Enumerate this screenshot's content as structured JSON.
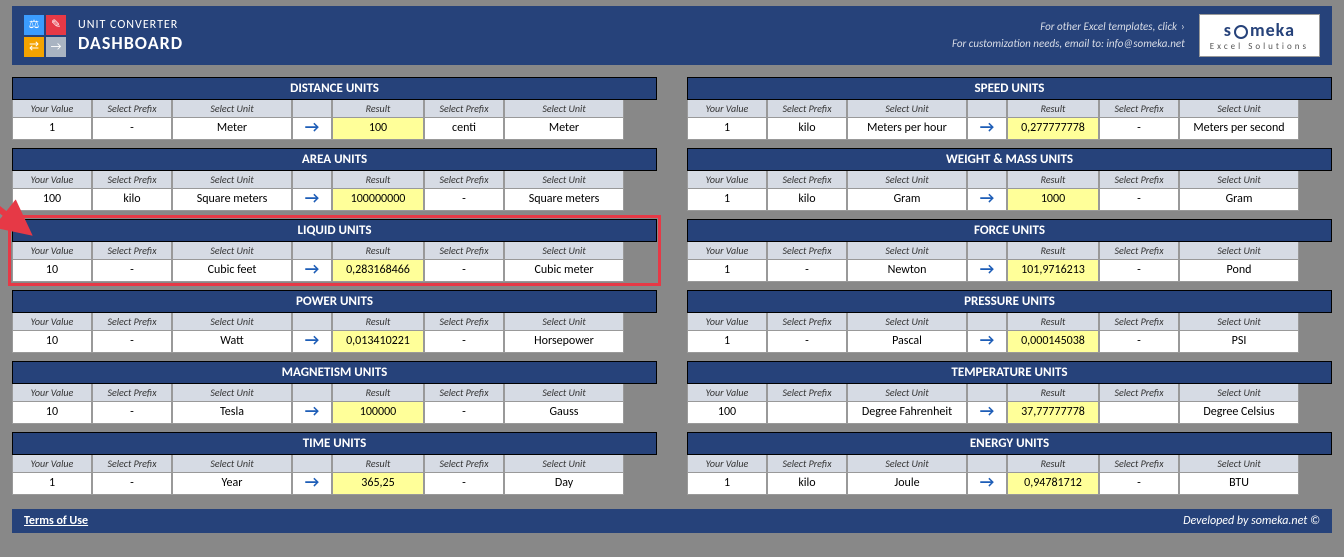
{
  "header": {
    "app": "UNIT CONVERTER",
    "title": "DASHBOARD",
    "line1": "For other Excel templates, click",
    "line2": "For customization needs, email to: info@someka.net",
    "brand": "someka",
    "brand_sub": "Excel Solutions"
  },
  "labels": {
    "your_value": "Your Value",
    "select_prefix": "Select Prefix",
    "select_unit": "Select Unit",
    "result": "Result"
  },
  "footer": {
    "terms": "Terms of Use",
    "dev": "Developed by someka.net ©"
  },
  "left": [
    {
      "title": "DISTANCE UNITS",
      "value": "1",
      "prefix": "-",
      "unit": "Meter",
      "result": "100",
      "prefix2": "centi",
      "unit2": "Meter",
      "hl": false
    },
    {
      "title": "AREA UNITS",
      "value": "100",
      "prefix": "kilo",
      "unit": "Square meters",
      "result": "100000000",
      "prefix2": "-",
      "unit2": "Square meters",
      "hl": false
    },
    {
      "title": "LIQUID UNITS",
      "value": "10",
      "prefix": "-",
      "unit": "Cubic feet",
      "result": "0,283168466",
      "prefix2": "-",
      "unit2": "Cubic meter",
      "hl": true
    },
    {
      "title": "POWER UNITS",
      "value": "10",
      "prefix": "-",
      "unit": "Watt",
      "result": "0,013410221",
      "prefix2": "-",
      "unit2": "Horsepower",
      "hl": false
    },
    {
      "title": "MAGNETISM UNITS",
      "value": "10",
      "prefix": "-",
      "unit": "Tesla",
      "result": "100000",
      "prefix2": "-",
      "unit2": "Gauss",
      "hl": false
    },
    {
      "title": "TIME UNITS",
      "value": "1",
      "prefix": "-",
      "unit": "Year",
      "result": "365,25",
      "prefix2": "-",
      "unit2": "Day",
      "hl": false
    }
  ],
  "right": [
    {
      "title": "SPEED UNITS",
      "value": "1",
      "prefix": "kilo",
      "unit": "Meters per hour",
      "result": "0,277777778",
      "prefix2": "-",
      "unit2": "Meters per second",
      "hl": false
    },
    {
      "title": "WEIGHT & MASS UNITS",
      "value": "1",
      "prefix": "kilo",
      "unit": "Gram",
      "result": "1000",
      "prefix2": "-",
      "unit2": "Gram",
      "hl": false
    },
    {
      "title": "FORCE UNITS",
      "value": "1",
      "prefix": "-",
      "unit": "Newton",
      "result": "101,9716213",
      "prefix2": "-",
      "unit2": "Pond",
      "hl": false
    },
    {
      "title": "PRESSURE UNITS",
      "value": "1",
      "prefix": "-",
      "unit": "Pascal",
      "result": "0,000145038",
      "prefix2": "-",
      "unit2": "PSI",
      "hl": false
    },
    {
      "title": "TEMPERATURE UNITS",
      "value": "100",
      "prefix": "",
      "unit": "Degree Fahrenheit",
      "result": "37,77777778",
      "prefix2": "",
      "unit2": "Degree Celsius",
      "hl": false
    },
    {
      "title": "ENERGY UNITS",
      "value": "1",
      "prefix": "kilo",
      "unit": "Joule",
      "result": "0,94781712",
      "prefix2": "-",
      "unit2": "BTU",
      "hl": false
    }
  ]
}
